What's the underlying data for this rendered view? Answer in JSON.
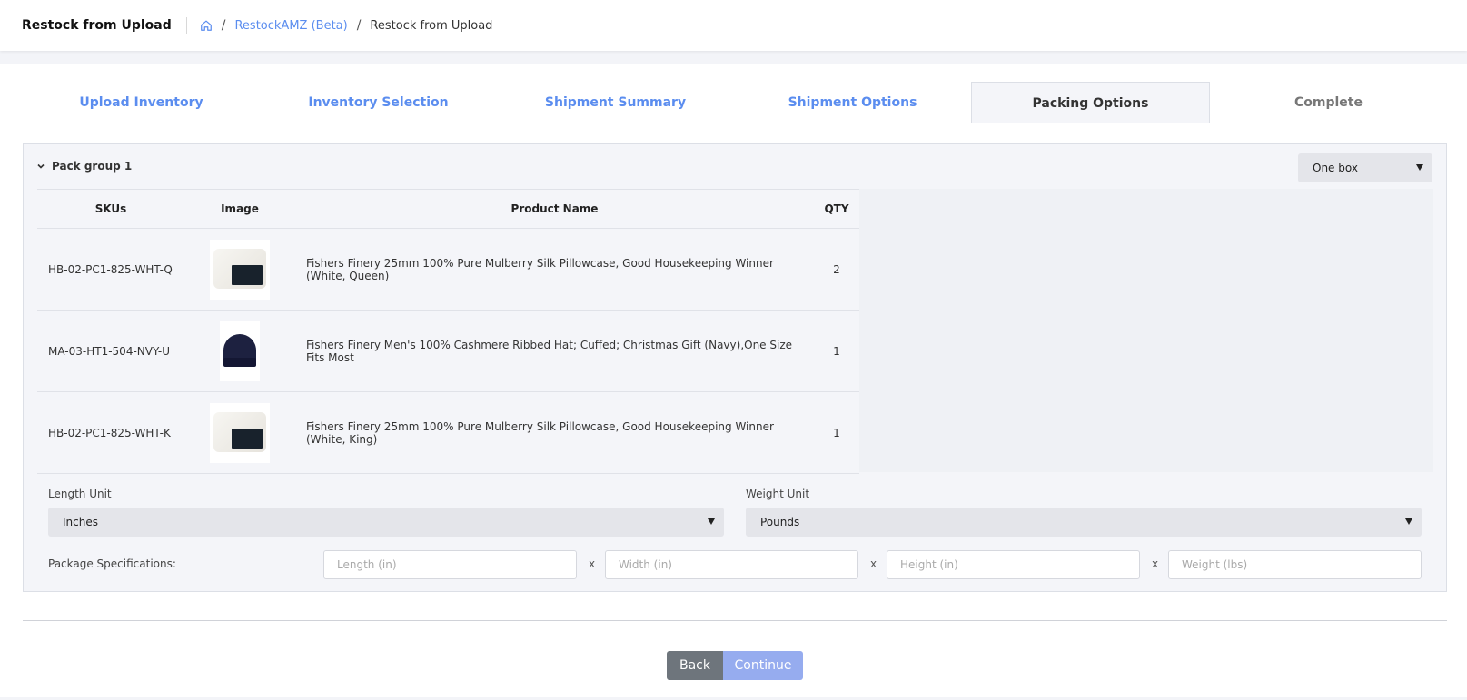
{
  "header": {
    "title": "Restock from Upload",
    "breadcrumb": {
      "link": "RestockAMZ (Beta)",
      "current": "Restock from Upload"
    }
  },
  "tabs": [
    {
      "label": "Upload Inventory"
    },
    {
      "label": "Inventory Selection"
    },
    {
      "label": "Shipment Summary"
    },
    {
      "label": "Shipment Options"
    },
    {
      "label": "Packing Options",
      "active": true
    },
    {
      "label": "Complete"
    }
  ],
  "pack_group": {
    "title": "Pack group 1",
    "box_option": "One box",
    "columns": {
      "sku": "SKUs",
      "image": "Image",
      "name": "Product Name",
      "qty": "QTY"
    },
    "rows": [
      {
        "sku": "HB-02-PC1-825-WHT-Q",
        "image": "pillowcase-image",
        "name": "Fishers Finery 25mm 100% Pure Mulberry Silk Pillowcase, Good Housekeeping Winner (White, Queen)",
        "qty": "2"
      },
      {
        "sku": "MA-03-HT1-504-NVY-U",
        "image": "hat-image",
        "name": "Fishers Finery Men's 100% Cashmere Ribbed Hat; Cuffed; Christmas Gift (Navy),One Size Fits Most",
        "qty": "1"
      },
      {
        "sku": "HB-02-PC1-825-WHT-K",
        "image": "pillowcase-image",
        "name": "Fishers Finery 25mm 100% Pure Mulberry Silk Pillowcase, Good Housekeeping Winner (White, King)",
        "qty": "1"
      }
    ],
    "length_unit": {
      "label": "Length Unit",
      "value": "Inches"
    },
    "weight_unit": {
      "label": "Weight Unit",
      "value": "Pounds"
    },
    "package_specs": {
      "label": "Package Specifications:",
      "separator": "x",
      "length_placeholder": "Length (in)",
      "width_placeholder": "Width (in)",
      "height_placeholder": "Height (in)",
      "weight_placeholder": "Weight (lbs)"
    }
  },
  "footer": {
    "back_label": "Back",
    "continue_label": "Continue"
  },
  "colors": {
    "link": "#5b8def",
    "continue": "#96acef",
    "back": "#6e757c"
  }
}
